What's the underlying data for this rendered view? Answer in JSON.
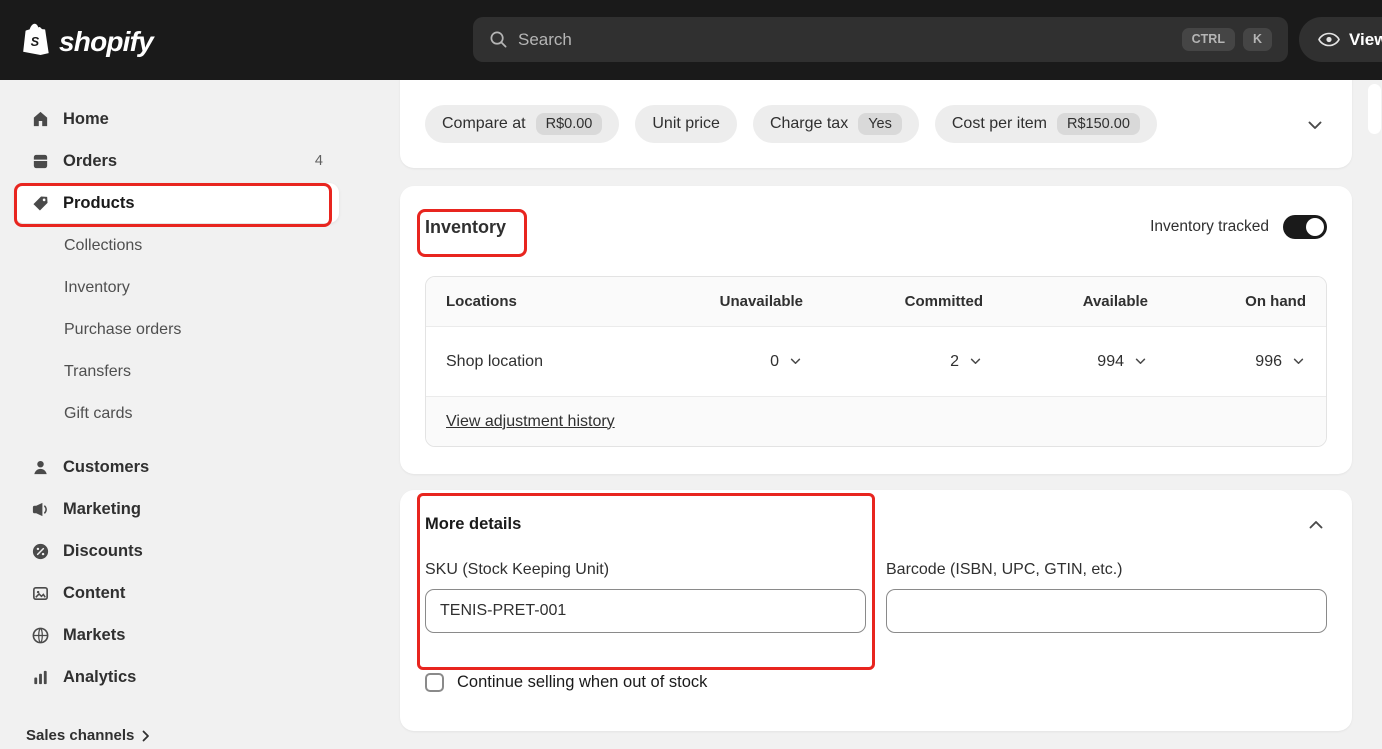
{
  "colors": {
    "annotation-red": "#e8251f",
    "toggle-on": "#1a1a1a"
  },
  "topbar": {
    "brand": "shopify",
    "search": {
      "placeholder": "Search",
      "shortcut": [
        "CTRL",
        "K"
      ]
    },
    "view_button_label": "View"
  },
  "sidebar": {
    "items": [
      {
        "label": "Home"
      },
      {
        "label": "Orders",
        "badge": "4"
      },
      {
        "label": "Products"
      },
      {
        "label": "Customers"
      },
      {
        "label": "Marketing"
      },
      {
        "label": "Discounts"
      },
      {
        "label": "Content"
      },
      {
        "label": "Markets"
      },
      {
        "label": "Analytics"
      }
    ],
    "products_subitems": [
      {
        "label": "Collections"
      },
      {
        "label": "Inventory"
      },
      {
        "label": "Purchase orders"
      },
      {
        "label": "Transfers"
      },
      {
        "label": "Gift cards"
      }
    ],
    "footer_label": "Sales channels"
  },
  "pricing_card": {
    "pills": [
      {
        "label": "Compare at",
        "value": "R$0.00"
      },
      {
        "label": "Unit price"
      },
      {
        "label": "Charge tax",
        "value": "Yes"
      },
      {
        "label": "Cost per item",
        "value": "R$150.00"
      }
    ]
  },
  "inventory_card": {
    "title": "Inventory",
    "tracked_label": "Inventory tracked",
    "tracked_on": true,
    "table": {
      "headers": [
        "Locations",
        "Unavailable",
        "Committed",
        "Available",
        "On hand"
      ],
      "rows": [
        {
          "location": "Shop location",
          "unavailable": "0",
          "committed": "2",
          "available": "994",
          "on_hand": "996"
        }
      ],
      "footer_link": "View adjustment history"
    }
  },
  "details_card": {
    "title": "More details",
    "sku_label": "SKU (Stock Keeping Unit)",
    "sku_value": "TENIS-PRET-001",
    "barcode_label": "Barcode (ISBN, UPC, GTIN, etc.)",
    "barcode_value": "",
    "checkbox_label": "Continue selling when out of stock",
    "checkbox_checked": false
  }
}
